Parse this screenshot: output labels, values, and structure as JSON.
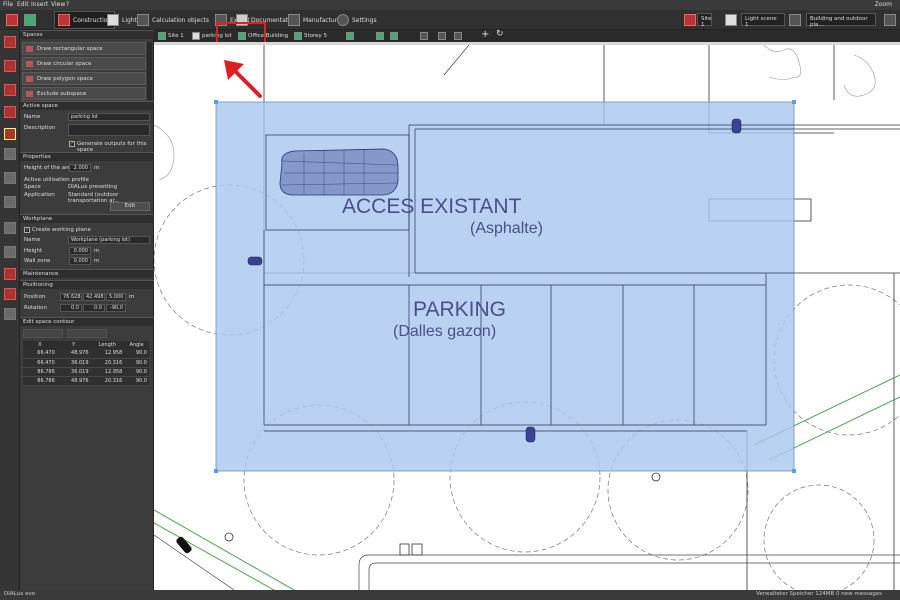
{
  "menubar": {
    "items": [
      "File",
      "Edit",
      "Insert",
      "View",
      "?"
    ],
    "zoom": "Zoom"
  },
  "toolbar": {
    "tabs": [
      "Construction",
      "Light",
      "Calculation objects",
      "Export",
      "Documentation",
      "Manufacturer",
      "Settings"
    ],
    "site": "Site 1",
    "light_scene": "Light scene 1",
    "view": "Building and outdoor pla..."
  },
  "canvas_toolbar": {
    "site": "Site 1",
    "space": "parking lot",
    "building": "Office Building",
    "storey": "Storey 5"
  },
  "panel": {
    "spaces_title": "Spaces",
    "space_tools": [
      "Draw rectangular space",
      "Draw circular space",
      "Draw polygon space",
      "Exclude subspace"
    ],
    "active_space_title": "Active space",
    "name_label": "Name",
    "name_value": "parking lot",
    "description_label": "Description",
    "description_value": "",
    "generate_outputs": "Generate outputs for this space",
    "properties_title": "Properties",
    "height_label": "Height of the area",
    "height_value": "2.000",
    "unit_m": "m",
    "active_profile_title": "Active utilisation profile",
    "space_label": "Space",
    "space_value": "DIALux presetting",
    "application_label": "Application",
    "application_value": "Standard (outdoor transportation ar...",
    "edit_button": "Edit",
    "workplane_title": "Workplane",
    "create_workplane": "Create working plane",
    "wp_name_label": "Name",
    "wp_name_value": "Workplane (parking lot)",
    "wp_height_label": "Height",
    "wp_height_value": "0.000",
    "wall_zone_label": "Wall zone",
    "wall_zone_value": "0.000",
    "maintenance_title": "Maintenance",
    "positioning_title": "Positioning",
    "position_label": "Position",
    "position_values": [
      "76.628",
      "42.498",
      "5.000"
    ],
    "rotation_label": "Rotation",
    "rotation_values": [
      "0.0",
      "0.0",
      "-90.0"
    ],
    "edit_contour_title": "Edit space contour",
    "contour_headers": [
      "X",
      "Y",
      "Length",
      "Angle"
    ],
    "contour_rows": [
      [
        "66.470",
        "48.976",
        "12.958",
        "90.0"
      ],
      [
        "66.470",
        "36.019",
        "20.316",
        "90.0"
      ],
      [
        "86.786",
        "36.019",
        "12.958",
        "90.0"
      ],
      [
        "86.786",
        "48.976",
        "20.316",
        "90.0"
      ]
    ]
  },
  "canvas": {
    "label_acces": "ACCES EXISTANT",
    "label_asphalte": "(Asphalte)",
    "label_parking": "PARKING",
    "label_dalles": "(Dalles gazon)"
  },
  "status": {
    "logo": "DIALux evo",
    "memory": "Verwalteter Speicher 124MB",
    "messages": "0 new messages"
  },
  "colors": {
    "space_fill": "#a9c8ee",
    "highlight": "#e02020",
    "label_text": "#4a4e8a"
  }
}
